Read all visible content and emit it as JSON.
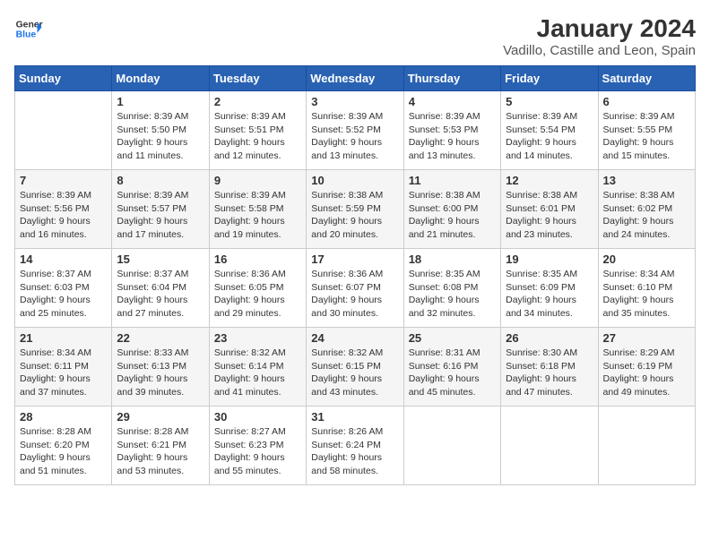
{
  "logo": {
    "line1": "General",
    "line2": "Blue"
  },
  "title": "January 2024",
  "location": "Vadillo, Castille and Leon, Spain",
  "headers": [
    "Sunday",
    "Monday",
    "Tuesday",
    "Wednesday",
    "Thursday",
    "Friday",
    "Saturday"
  ],
  "weeks": [
    [
      {
        "day": "",
        "sunrise": "",
        "sunset": "",
        "daylight": ""
      },
      {
        "day": "1",
        "sunrise": "Sunrise: 8:39 AM",
        "sunset": "Sunset: 5:50 PM",
        "daylight": "Daylight: 9 hours and 11 minutes."
      },
      {
        "day": "2",
        "sunrise": "Sunrise: 8:39 AM",
        "sunset": "Sunset: 5:51 PM",
        "daylight": "Daylight: 9 hours and 12 minutes."
      },
      {
        "day": "3",
        "sunrise": "Sunrise: 8:39 AM",
        "sunset": "Sunset: 5:52 PM",
        "daylight": "Daylight: 9 hours and 13 minutes."
      },
      {
        "day": "4",
        "sunrise": "Sunrise: 8:39 AM",
        "sunset": "Sunset: 5:53 PM",
        "daylight": "Daylight: 9 hours and 13 minutes."
      },
      {
        "day": "5",
        "sunrise": "Sunrise: 8:39 AM",
        "sunset": "Sunset: 5:54 PM",
        "daylight": "Daylight: 9 hours and 14 minutes."
      },
      {
        "day": "6",
        "sunrise": "Sunrise: 8:39 AM",
        "sunset": "Sunset: 5:55 PM",
        "daylight": "Daylight: 9 hours and 15 minutes."
      }
    ],
    [
      {
        "day": "7",
        "sunrise": "Sunrise: 8:39 AM",
        "sunset": "Sunset: 5:56 PM",
        "daylight": "Daylight: 9 hours and 16 minutes."
      },
      {
        "day": "8",
        "sunrise": "Sunrise: 8:39 AM",
        "sunset": "Sunset: 5:57 PM",
        "daylight": "Daylight: 9 hours and 17 minutes."
      },
      {
        "day": "9",
        "sunrise": "Sunrise: 8:39 AM",
        "sunset": "Sunset: 5:58 PM",
        "daylight": "Daylight: 9 hours and 19 minutes."
      },
      {
        "day": "10",
        "sunrise": "Sunrise: 8:38 AM",
        "sunset": "Sunset: 5:59 PM",
        "daylight": "Daylight: 9 hours and 20 minutes."
      },
      {
        "day": "11",
        "sunrise": "Sunrise: 8:38 AM",
        "sunset": "Sunset: 6:00 PM",
        "daylight": "Daylight: 9 hours and 21 minutes."
      },
      {
        "day": "12",
        "sunrise": "Sunrise: 8:38 AM",
        "sunset": "Sunset: 6:01 PM",
        "daylight": "Daylight: 9 hours and 23 minutes."
      },
      {
        "day": "13",
        "sunrise": "Sunrise: 8:38 AM",
        "sunset": "Sunset: 6:02 PM",
        "daylight": "Daylight: 9 hours and 24 minutes."
      }
    ],
    [
      {
        "day": "14",
        "sunrise": "Sunrise: 8:37 AM",
        "sunset": "Sunset: 6:03 PM",
        "daylight": "Daylight: 9 hours and 25 minutes."
      },
      {
        "day": "15",
        "sunrise": "Sunrise: 8:37 AM",
        "sunset": "Sunset: 6:04 PM",
        "daylight": "Daylight: 9 hours and 27 minutes."
      },
      {
        "day": "16",
        "sunrise": "Sunrise: 8:36 AM",
        "sunset": "Sunset: 6:05 PM",
        "daylight": "Daylight: 9 hours and 29 minutes."
      },
      {
        "day": "17",
        "sunrise": "Sunrise: 8:36 AM",
        "sunset": "Sunset: 6:07 PM",
        "daylight": "Daylight: 9 hours and 30 minutes."
      },
      {
        "day": "18",
        "sunrise": "Sunrise: 8:35 AM",
        "sunset": "Sunset: 6:08 PM",
        "daylight": "Daylight: 9 hours and 32 minutes."
      },
      {
        "day": "19",
        "sunrise": "Sunrise: 8:35 AM",
        "sunset": "Sunset: 6:09 PM",
        "daylight": "Daylight: 9 hours and 34 minutes."
      },
      {
        "day": "20",
        "sunrise": "Sunrise: 8:34 AM",
        "sunset": "Sunset: 6:10 PM",
        "daylight": "Daylight: 9 hours and 35 minutes."
      }
    ],
    [
      {
        "day": "21",
        "sunrise": "Sunrise: 8:34 AM",
        "sunset": "Sunset: 6:11 PM",
        "daylight": "Daylight: 9 hours and 37 minutes."
      },
      {
        "day": "22",
        "sunrise": "Sunrise: 8:33 AM",
        "sunset": "Sunset: 6:13 PM",
        "daylight": "Daylight: 9 hours and 39 minutes."
      },
      {
        "day": "23",
        "sunrise": "Sunrise: 8:32 AM",
        "sunset": "Sunset: 6:14 PM",
        "daylight": "Daylight: 9 hours and 41 minutes."
      },
      {
        "day": "24",
        "sunrise": "Sunrise: 8:32 AM",
        "sunset": "Sunset: 6:15 PM",
        "daylight": "Daylight: 9 hours and 43 minutes."
      },
      {
        "day": "25",
        "sunrise": "Sunrise: 8:31 AM",
        "sunset": "Sunset: 6:16 PM",
        "daylight": "Daylight: 9 hours and 45 minutes."
      },
      {
        "day": "26",
        "sunrise": "Sunrise: 8:30 AM",
        "sunset": "Sunset: 6:18 PM",
        "daylight": "Daylight: 9 hours and 47 minutes."
      },
      {
        "day": "27",
        "sunrise": "Sunrise: 8:29 AM",
        "sunset": "Sunset: 6:19 PM",
        "daylight": "Daylight: 9 hours and 49 minutes."
      }
    ],
    [
      {
        "day": "28",
        "sunrise": "Sunrise: 8:28 AM",
        "sunset": "Sunset: 6:20 PM",
        "daylight": "Daylight: 9 hours and 51 minutes."
      },
      {
        "day": "29",
        "sunrise": "Sunrise: 8:28 AM",
        "sunset": "Sunset: 6:21 PM",
        "daylight": "Daylight: 9 hours and 53 minutes."
      },
      {
        "day": "30",
        "sunrise": "Sunrise: 8:27 AM",
        "sunset": "Sunset: 6:23 PM",
        "daylight": "Daylight: 9 hours and 55 minutes."
      },
      {
        "day": "31",
        "sunrise": "Sunrise: 8:26 AM",
        "sunset": "Sunset: 6:24 PM",
        "daylight": "Daylight: 9 hours and 58 minutes."
      },
      {
        "day": "",
        "sunrise": "",
        "sunset": "",
        "daylight": ""
      },
      {
        "day": "",
        "sunrise": "",
        "sunset": "",
        "daylight": ""
      },
      {
        "day": "",
        "sunrise": "",
        "sunset": "",
        "daylight": ""
      }
    ]
  ]
}
